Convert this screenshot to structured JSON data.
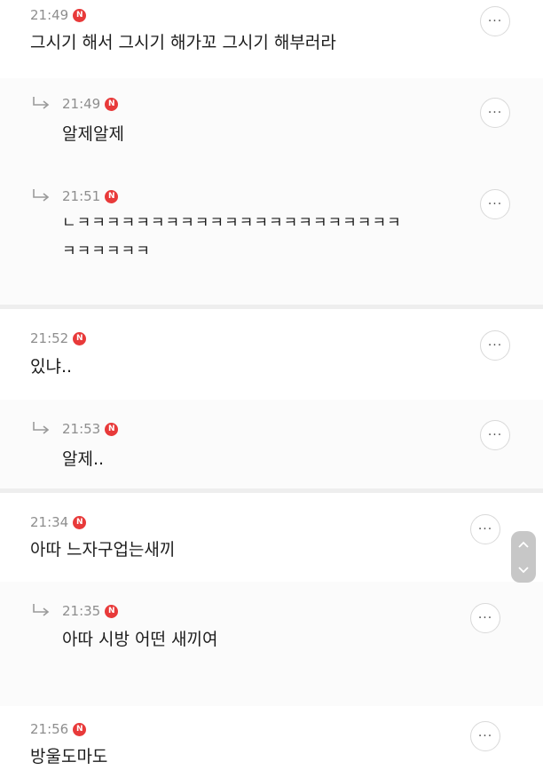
{
  "comments": [
    {
      "time": "21:49",
      "badge": "N",
      "text": "그시기 해서 그시기 해가꼬 그시기 해부러라",
      "more": "···"
    },
    {
      "time": "21:49",
      "badge": "N",
      "text": "알제알제",
      "more": "···"
    },
    {
      "time": "21:51",
      "badge": "N",
      "text_line1": "ㄴㅋㅋㅋㅋㅋㅋㅋㅋㅋㅋㅋㅋㅋㅋㅋㅋㅋㅋㅋㅋㅋㅋ",
      "text_line2": "ㅋㅋㅋㅋㅋㅋ",
      "more": "···"
    },
    {
      "time": "21:52",
      "badge": "N",
      "text": "있냐..",
      "more": "···"
    },
    {
      "time": "21:53",
      "badge": "N",
      "text": "알제..",
      "more": "···"
    },
    {
      "time": "21:34",
      "badge": "N",
      "text": "아따 느자구업는새끼",
      "more": "···"
    },
    {
      "time": "21:35",
      "badge": "N",
      "text": "아따 시방 어떤 새끼여",
      "more": "···"
    },
    {
      "time": "21:56",
      "badge": "N",
      "text": "방울도마도",
      "more": "···"
    }
  ]
}
